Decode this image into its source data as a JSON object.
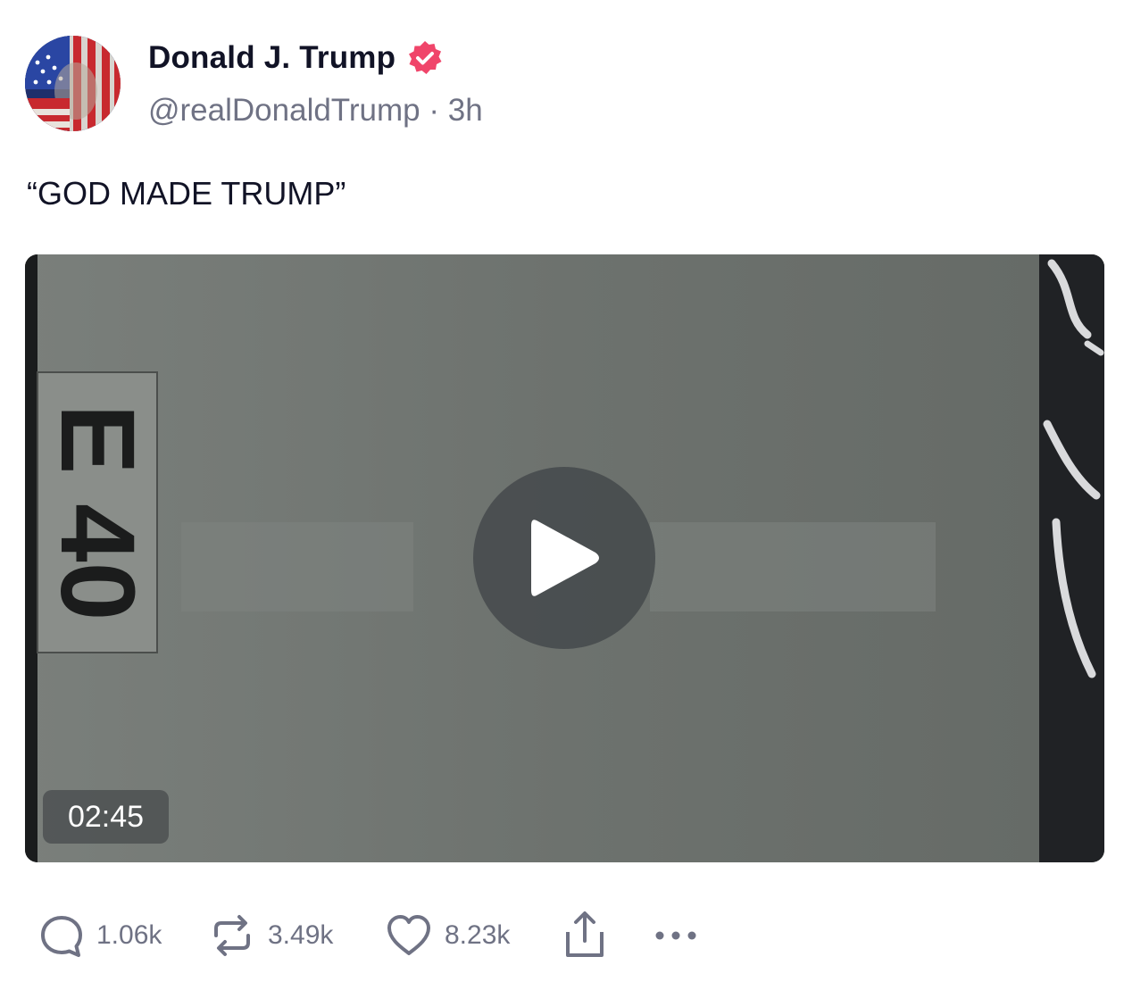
{
  "post": {
    "author_name": "Donald J. Trump",
    "handle_line": "@realDonaldTrump · 3h",
    "text": "“GOD MADE TRUMP”"
  },
  "video": {
    "duration": "02:45",
    "sign_text": "E 40"
  },
  "actions": {
    "replies": "1.06k",
    "reposts": "3.49k",
    "likes": "8.23k"
  },
  "icons": {
    "verified": "verified-badge-icon",
    "reply": "speech-bubble-icon",
    "repost": "repost-arrows-icon",
    "like": "heart-icon",
    "share": "share-upload-icon",
    "more": "more-dots-icon",
    "play": "play-icon"
  },
  "colors": {
    "verified_badge": "#f0456a",
    "name": "#111326",
    "muted": "#6f7284",
    "video_bg": "#6c716d"
  }
}
